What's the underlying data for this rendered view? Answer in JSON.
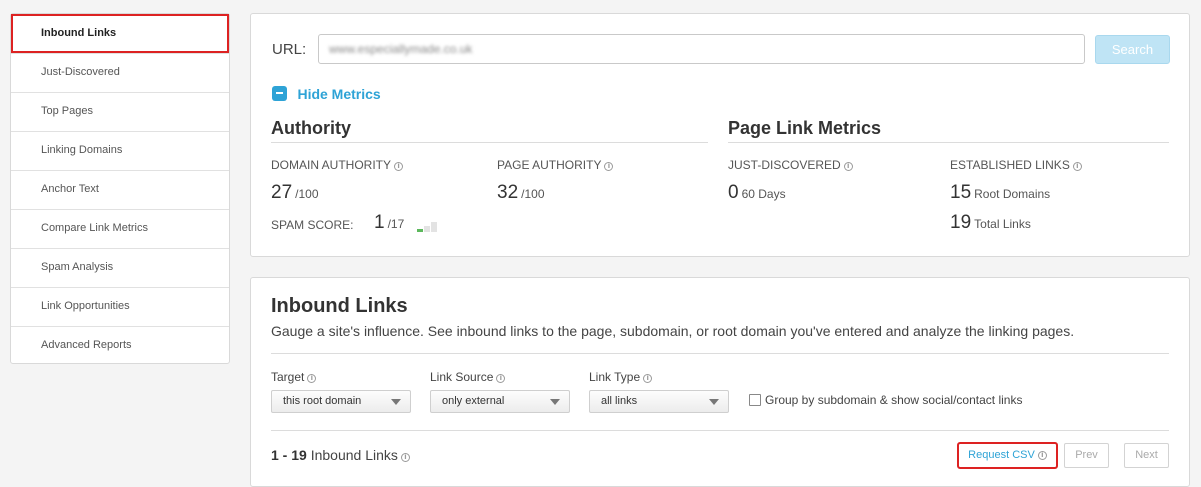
{
  "sidebar": {
    "items": [
      {
        "label": "Inbound Links",
        "active": true
      },
      {
        "label": "Just-Discovered"
      },
      {
        "label": "Top Pages"
      },
      {
        "label": "Linking Domains"
      },
      {
        "label": "Anchor Text"
      },
      {
        "label": "Compare Link Metrics"
      },
      {
        "label": "Spam Analysis"
      },
      {
        "label": "Link Opportunities"
      },
      {
        "label": "Advanced Reports"
      }
    ]
  },
  "search": {
    "url_label": "URL:",
    "url_value": "www.especiallymade.co.uk",
    "button_label": "Search"
  },
  "metrics": {
    "toggle_label": "Hide Metrics",
    "authority": {
      "title": "Authority",
      "domain_authority_label": "DOMAIN AUTHORITY",
      "domain_authority_value": "27",
      "domain_authority_unit": "/100",
      "page_authority_label": "PAGE AUTHORITY",
      "page_authority_value": "32",
      "page_authority_unit": "/100",
      "spam_score_label": "SPAM SCORE:",
      "spam_score_value": "1",
      "spam_score_unit": "/17"
    },
    "page_link": {
      "title": "Page Link Metrics",
      "just_discovered_label": "JUST-DISCOVERED",
      "just_discovered_value": "0",
      "just_discovered_unit": "60 Days",
      "established_label": "ESTABLISHED LINKS",
      "root_domains_value": "15",
      "root_domains_unit": "Root Domains",
      "total_links_value": "19",
      "total_links_unit": "Total Links"
    }
  },
  "inbound": {
    "title": "Inbound Links",
    "description": "Gauge a site's influence. See inbound links to the page, subdomain, or root domain you've entered and analyze the linking pages.",
    "filters": {
      "target_label": "Target",
      "target_value": "this root domain",
      "source_label": "Link Source",
      "source_value": "only external",
      "type_label": "Link Type",
      "type_value": "all links",
      "group_label": "Group by subdomain & show social/contact links"
    },
    "results_range": "1 - 19",
    "results_label": "Inbound Links",
    "csv_label": "Request CSV",
    "prev_label": "Prev",
    "next_label": "Next"
  },
  "colors": {
    "accent": "#2ea3d6",
    "highlight_border": "#dd2222",
    "spam_green": "#5cb85c"
  }
}
